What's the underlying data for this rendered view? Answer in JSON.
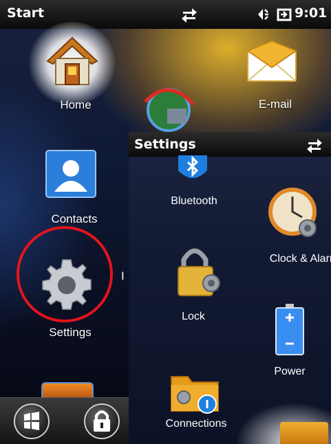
{
  "statusbar": {
    "title": "Start",
    "time": "9:01",
    "icons": [
      "sync-arrows-icon",
      "speaker-mute-icon",
      "battery-plug-icon"
    ]
  },
  "start_tiles": [
    {
      "label": "Home",
      "icon": "house-icon"
    },
    {
      "label": "E-mail",
      "icon": "envelope-icon"
    },
    {
      "label": "Contacts",
      "icon": "contact-card-icon"
    },
    {
      "label": "Settings",
      "icon": "gear-icon"
    }
  ],
  "partial_label": "I",
  "taskbar": {
    "buttons": [
      "windows-start-icon",
      "lock-icon"
    ]
  },
  "settings_panel": {
    "title": "Settings",
    "items": [
      {
        "label": "Bluetooth",
        "icon": "bluetooth-icon"
      },
      {
        "label": "Clock & Alarm",
        "icon": "clock-gear-icon"
      },
      {
        "label": "Lock",
        "icon": "padlock-gear-icon"
      },
      {
        "label": "Power",
        "icon": "battery-icon"
      },
      {
        "label": "Connections",
        "icon": "folder-gear-icon"
      }
    ]
  },
  "colors": {
    "highlight": "#e3141b",
    "accent": "#f5b21a"
  }
}
